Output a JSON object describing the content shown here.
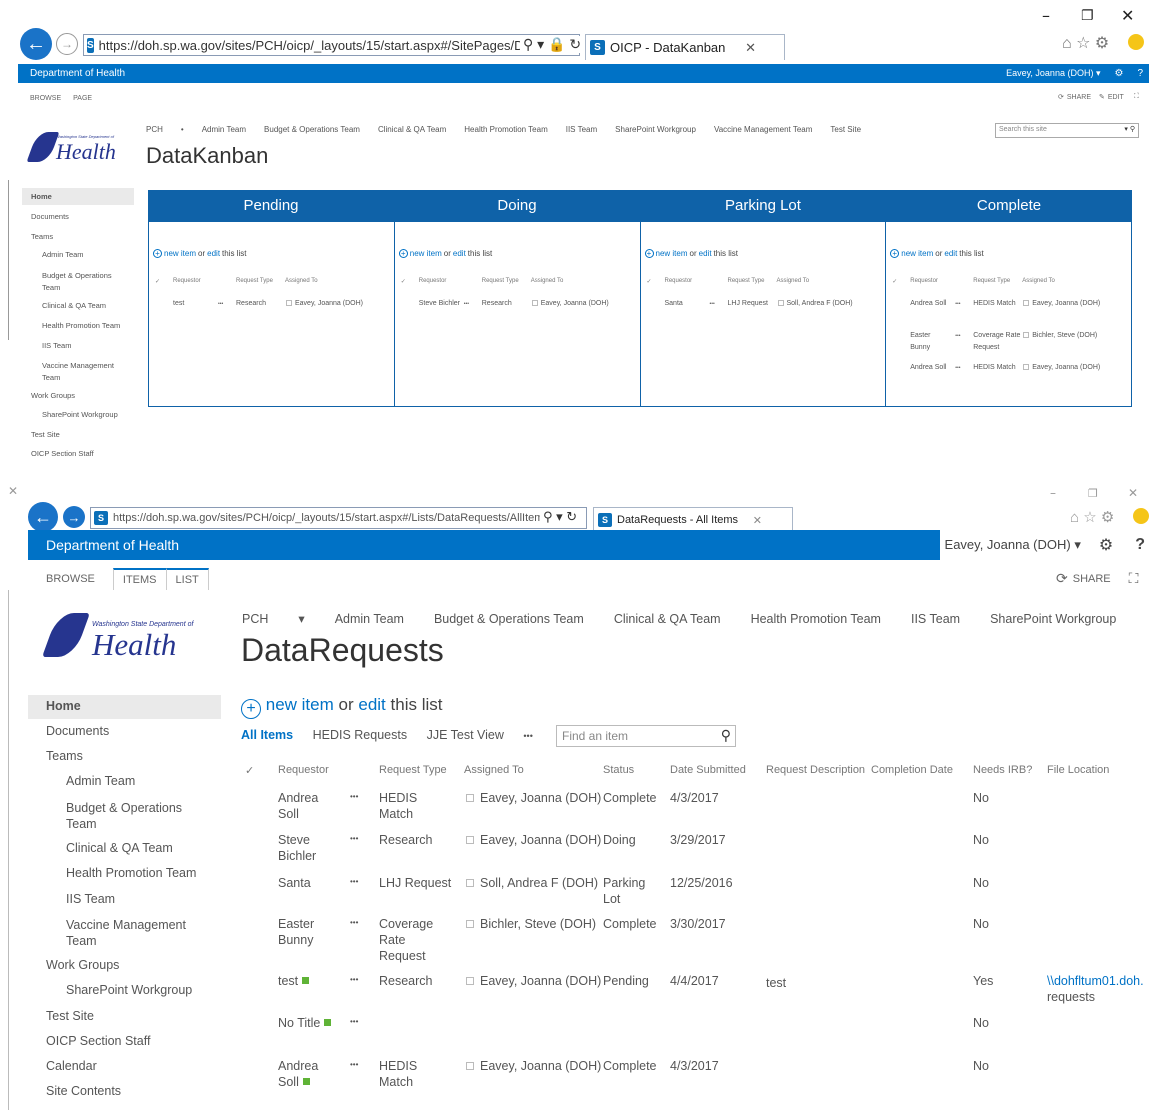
{
  "top": {
    "url": "https://doh.sp.wa.gov/sites/PCH/oicp/_layouts/15/start.aspx#/SitePages/DataKanban.as",
    "url_domain": "wa.gov",
    "tab_title": "OICP - DataKanban",
    "suite_title": "Department of Health",
    "user": "Eavey, Joanna (DOH) ▾",
    "ribbon": [
      "BROWSE",
      "PAGE"
    ],
    "share": "SHARE",
    "edit": "EDIT",
    "nav": [
      "PCH",
      "Admin Team",
      "Budget & Operations Team",
      "Clinical & QA Team",
      "Health Promotion Team",
      "IIS Team",
      "SharePoint Workgroup",
      "Vaccine Management Team",
      "Test Site"
    ],
    "search_placeholder": "Search this site",
    "page_title": "DataKanban",
    "logo_small": "Washington State Department of",
    "logo_big": "Health",
    "left_nav": [
      "Home",
      "Documents",
      "Teams",
      "Admin Team",
      "Budget & Operations Team",
      "Clinical & QA Team",
      "Health Promotion Team",
      "IIS Team",
      "Vaccine Management Team",
      "Work Groups",
      "SharePoint Workgroup",
      "Test Site",
      "OICP Section Staff"
    ],
    "columns_kanban": [
      "Pending",
      "Doing",
      "Parking Lot",
      "Complete"
    ],
    "new_item": "new item",
    "or": "or",
    "edit_link": "edit",
    "this_list": "this list",
    "col_headers": [
      "Requestor",
      "Request Type",
      "Assigned To"
    ],
    "ellipsis": "•••",
    "check": "✓",
    "pending_items": [
      {
        "req": "test",
        "type": "Research",
        "assigned": "Eavey, Joanna (DOH)"
      }
    ],
    "doing_items": [
      {
        "req": "Steve Bichler",
        "type": "Research",
        "assigned": "Eavey, Joanna (DOH)"
      }
    ],
    "parking_items": [
      {
        "req": "Santa",
        "type": "LHJ Request",
        "assigned": "Soll, Andrea F (DOH)"
      }
    ],
    "complete_items": [
      {
        "req": "Andrea Soll",
        "type": "HEDIS Match",
        "assigned": "Eavey, Joanna (DOH)"
      },
      {
        "req": "Easter Bunny",
        "type": "Coverage Rate Request",
        "assigned": "Bichler, Steve (DOH)"
      },
      {
        "req": "Andrea Soll",
        "type": "HEDIS Match",
        "assigned": "Eavey, Joanna (DOH)"
      }
    ]
  },
  "bottom": {
    "url": "https://doh.sp.wa.gov/sites/PCH/oicp/_layouts/15/start.aspx#/Lists/DataRequests/AllItems.",
    "url_domain": "wa.gov",
    "tab_title": "DataRequests - All Items",
    "suite_title": "Department of Health",
    "user": "Eavey, Joanna (DOH) ▾",
    "ribbon": [
      "BROWSE",
      "ITEMS",
      "LIST"
    ],
    "share": "SHARE",
    "nav": [
      "PCH",
      "Admin Team",
      "Budget & Operations Team",
      "Clinical & QA Team",
      "Health Promotion Team",
      "IIS Team",
      "SharePoint Workgroup"
    ],
    "page_title": "DataRequests",
    "logo_small": "Washington State Department of",
    "logo_big": "Health",
    "left_nav": [
      "Home",
      "Documents",
      "Teams",
      "Admin Team",
      "Budget & Operations Team",
      "Clinical & QA Team",
      "Health Promotion Team",
      "IIS Team",
      "Vaccine Management Team",
      "Work Groups",
      "SharePoint Workgroup",
      "Test Site",
      "OICP Section Staff",
      "Calendar",
      "Site Contents"
    ],
    "new_item": "new item",
    "or": "or",
    "edit_link": "edit",
    "this_list": "this list",
    "views": [
      "All Items",
      "HEDIS Requests",
      "JJE Test View",
      "•••"
    ],
    "find_placeholder": "Find an item",
    "headers": [
      "Requestor",
      "Request Type",
      "Assigned To",
      "Status",
      "Date Submitted",
      "Request Description",
      "Completion Date",
      "Needs IRB?",
      "File Location"
    ],
    "ellipsis": "•••",
    "check": "✓",
    "rows": [
      {
        "req": "Andrea Soll",
        "type": "HEDIS Match",
        "assigned": "Eavey, Joanna (DOH)",
        "status": "Complete",
        "date": "4/3/2017",
        "desc": "",
        "irb": "No",
        "file": "",
        "new": false
      },
      {
        "req": "Steve Bichler",
        "type": "Research",
        "assigned": "Eavey, Joanna (DOH)",
        "status": "Doing",
        "date": "3/29/2017",
        "desc": "",
        "irb": "No",
        "file": "",
        "new": false
      },
      {
        "req": "Santa",
        "type": "LHJ Request",
        "assigned": "Soll, Andrea F (DOH)",
        "status": "Parking Lot",
        "date": "12/25/2016",
        "desc": "",
        "irb": "No",
        "file": "",
        "new": false
      },
      {
        "req": "Easter Bunny",
        "type": "Coverage Rate Request",
        "assigned": "Bichler, Steve (DOH)",
        "status": "Complete",
        "date": "3/30/2017",
        "desc": "",
        "irb": "No",
        "file": "",
        "new": false
      },
      {
        "req": "test",
        "type": "Research",
        "assigned": "Eavey, Joanna (DOH)",
        "status": "Pending",
        "date": "4/4/2017",
        "desc": "test",
        "irb": "Yes",
        "file": "\\\\dohfltum01.doh.",
        "file2": "requests",
        "new": true
      },
      {
        "req": "No Title",
        "type": "",
        "assigned": "",
        "status": "",
        "date": "",
        "desc": "",
        "irb": "No",
        "file": "",
        "new": true
      },
      {
        "req": "Andrea Soll",
        "type": "HEDIS Match",
        "assigned": "Eavey, Joanna (DOH)",
        "status": "Complete",
        "date": "4/3/2017",
        "desc": "",
        "irb": "No",
        "file": "",
        "new": true
      }
    ]
  },
  "colors": {
    "suite": "#0072c6",
    "kanban": "#0f62a8",
    "link": "#0072c6"
  }
}
